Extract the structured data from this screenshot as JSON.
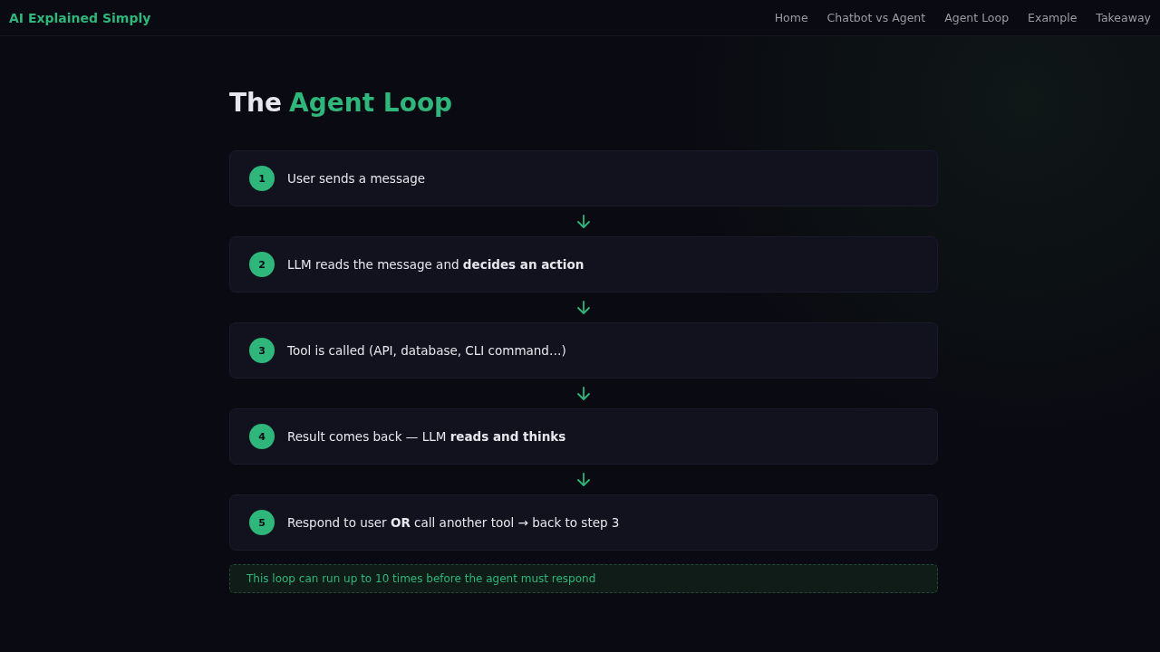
{
  "header": {
    "brand": "AI Explained Simply",
    "nav": [
      {
        "label": "Home"
      },
      {
        "label": "Chatbot vs Agent"
      },
      {
        "label": "Agent Loop"
      },
      {
        "label": "Example"
      },
      {
        "label": "Takeaway"
      }
    ]
  },
  "title": {
    "lead": "The",
    "highlight": "Agent Loop"
  },
  "steps": [
    {
      "number": "1",
      "text": "User sends a message"
    },
    {
      "number": "2",
      "text": "LLM reads the message and **decides an action**"
    },
    {
      "number": "3",
      "text": "Tool is called (API, database, CLI command…)"
    },
    {
      "number": "4",
      "text": "Result comes back — LLM **reads and thinks**"
    },
    {
      "number": "5",
      "text": "Respond to user **OR** call another tool → back to step 3"
    }
  ],
  "note": "This loop can run up to 10 times before the agent must respond"
}
